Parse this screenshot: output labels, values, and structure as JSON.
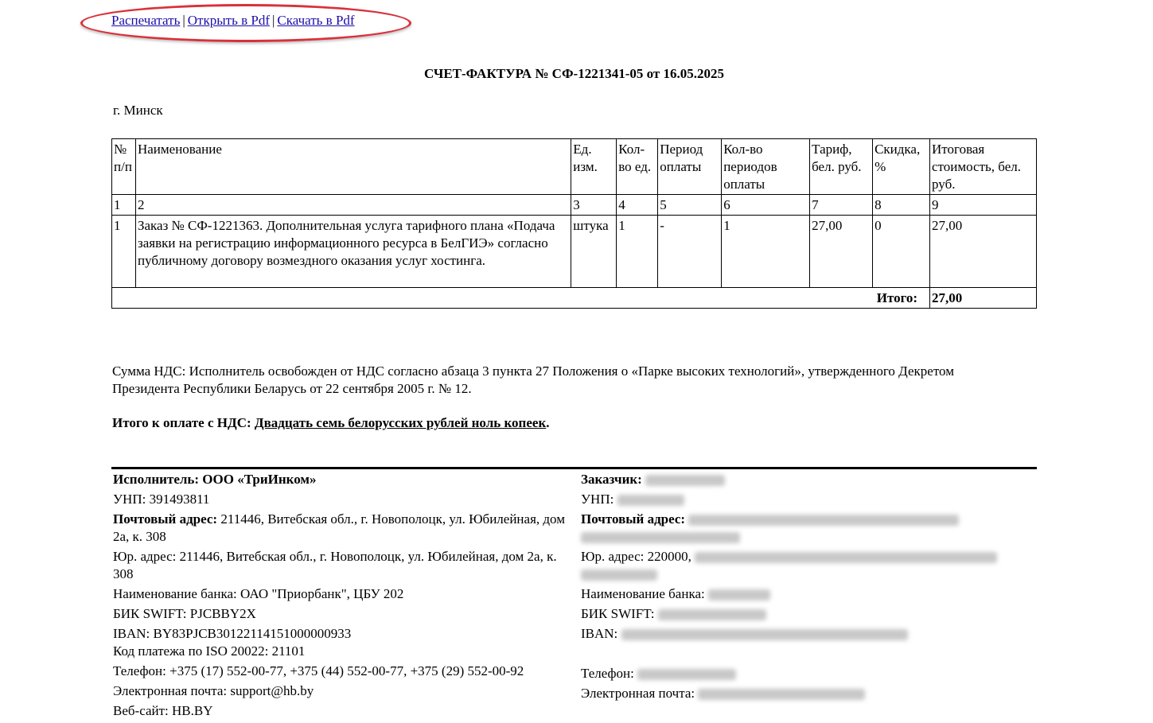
{
  "links": {
    "print": "Распечатать",
    "sep1": "|",
    "open_pdf": "Открыть в Pdf",
    "sep2": "|",
    "download_pdf": "Скачать в Pdf"
  },
  "title": "СЧЕТ-ФАКТУРА № СФ-1221341-05 от 16.05.2025",
  "city": "г. Минск",
  "table": {
    "headers": [
      "№ п/п",
      "Наименование",
      "Ед. изм.",
      "Кол-во ед.",
      "Период оплаты",
      "Кол-во периодов оплаты",
      "Тариф, бел. руб.",
      "Скидка, %",
      "Итоговая стоимость, бел. руб."
    ],
    "numbers": [
      "1",
      "2",
      "3",
      "4",
      "5",
      "6",
      "7",
      "8",
      "9"
    ],
    "rows": [
      [
        "1",
        "Заказ № СФ-1221363. Дополнительная услуга тарифного плана «Подача заявки на регистрацию информационного ресурса в БелГИЭ» согласно публичному договору возмездного оказания услуг хостинга.",
        "штука",
        "1",
        "-",
        "1",
        "27,00",
        "0",
        "27,00"
      ]
    ],
    "total_label": "Итого:",
    "total_value": "27,00"
  },
  "vat_text": "Сумма НДС: Исполнитель освобожден от НДС согласно абзаца 3 пункта 27 Положения о «Парке высоких технологий», утвержденного Декретом Президента Республики Беларусь от 22 сентября 2005 г. № 12.",
  "to_pay": {
    "label": "Итого к оплате с НДС:",
    "words": "Двадцать семь белорусских рублей ноль копеек",
    "dot": "."
  },
  "executor": {
    "title": "Исполнитель: ООО «ТриИнком»",
    "unp": "УНП: 391493811",
    "postal_label": "Почтовый адрес:",
    "postal_value": " 211446, Витебская обл., г. Новополоцк, ул. Юбилейная, дом 2а, к. 308",
    "legal": "Юр. адрес: 211446, Витебская обл., г. Новополоцк, ул. Юбилейная, дом 2а, к. 308",
    "bank": "Наименование банка: ОАО \"Приорбанк\", ЦБУ 202",
    "swift": "БИК SWIFT: PJCBBY2X",
    "iban": "IBAN: BY83PJCB30122114151000000933",
    "iso": "Код платежа по ISO 20022: 21101",
    "phone": "Телефон: +375 (17) 552-00-77, +375 (44) 552-00-77, +375 (29) 552-00-92",
    "email": "Электронная почта: support@hb.by",
    "website": "Веб-сайт: HB.BY"
  },
  "customer": {
    "title": "Заказчик:",
    "unp": "УНП:",
    "postal_label": "Почтовый адрес:",
    "legal": "Юр. адрес: 220000,",
    "bank": "Наименование банка:",
    "swift": "БИК SWIFT:",
    "iban": "IBAN:",
    "phone": "Телефон:",
    "email": "Электронная почта:"
  }
}
